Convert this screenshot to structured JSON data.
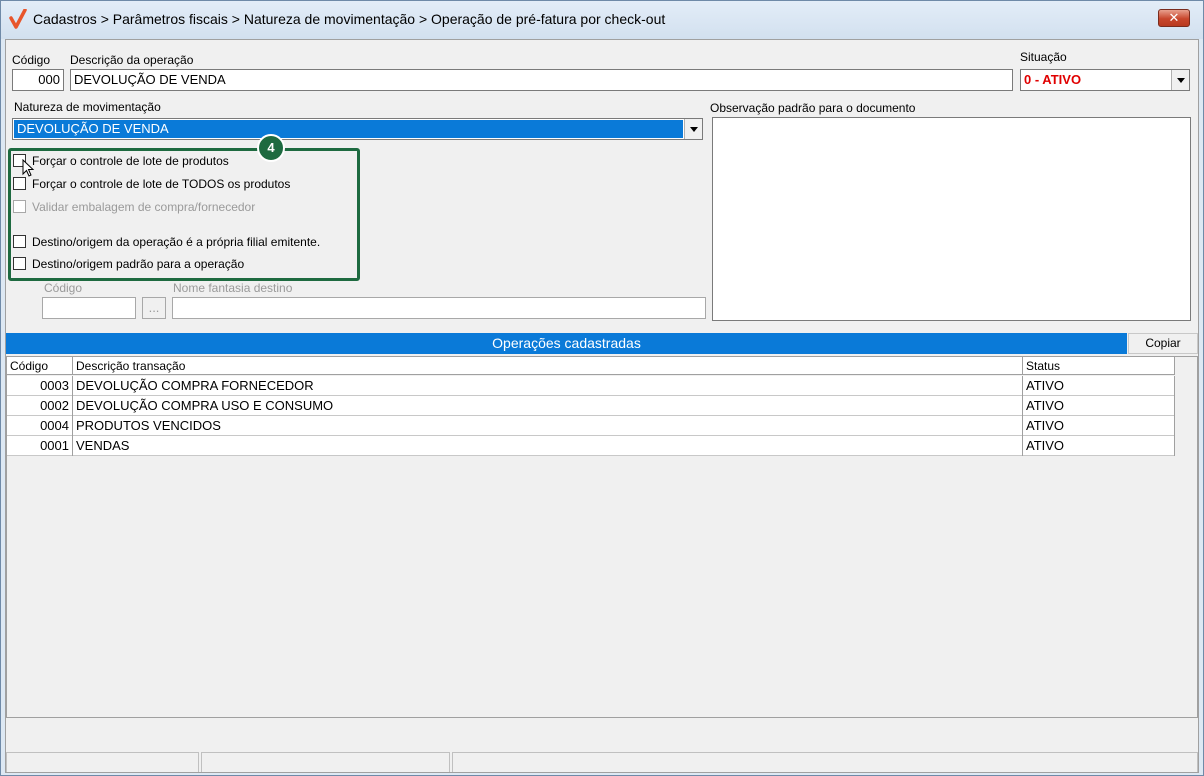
{
  "window": {
    "title": "Cadastros > Parâmetros fiscais > Natureza de movimentação > Operação de pré-fatura por check-out",
    "close_label": "✕",
    "logo_color": "#e8552b"
  },
  "form": {
    "codigo_label": "Código",
    "codigo_value": "000",
    "descricao_label": "Descrição da operação",
    "descricao_value": "DEVOLUÇÃO DE VENDA",
    "situacao_label": "Situação",
    "situacao_value": "0 - ATIVO",
    "situacao_color": "#e00000",
    "natureza_label": "Natureza de movimentação",
    "natureza_value": "DEVOLUÇÃO DE VENDA",
    "observacao_label": "Observação padrão para o documento",
    "observacao_value": ""
  },
  "checkboxes": [
    {
      "label": "Forçar o controle de lote de produtos",
      "checked": false,
      "enabled": true
    },
    {
      "label": "Forçar o controle de lote de TODOS os produtos",
      "checked": false,
      "enabled": true
    },
    {
      "label": "Validar embalagem de compra/fornecedor",
      "checked": false,
      "enabled": false
    },
    {
      "label": "Destino/origem da operação é a própria filial emitente.",
      "checked": false,
      "enabled": true
    },
    {
      "label": "Destino/origem padrão para a operação",
      "checked": false,
      "enabled": true
    }
  ],
  "highlight": {
    "badge": "4",
    "color": "#1e6a40"
  },
  "destino": {
    "codigo_label": "Código",
    "codigo_value": "",
    "browse_label": "...",
    "nome_label": "Nome fantasia destino",
    "nome_value": ""
  },
  "operacoes": {
    "title": "Operações cadastradas",
    "copy_label": "Copiar",
    "columns": [
      "Código",
      "Descrição transação",
      "Status"
    ],
    "rows": [
      {
        "codigo": "0003",
        "descricao": "DEVOLUÇÃO COMPRA FORNECEDOR",
        "status": "ATIVO"
      },
      {
        "codigo": "0002",
        "descricao": "DEVOLUÇÃO COMPRA USO E CONSUMO",
        "status": "ATIVO"
      },
      {
        "codigo": "0004",
        "descricao": "PRODUTOS VENCIDOS",
        "status": "ATIVO"
      },
      {
        "codigo": "0001",
        "descricao": "VENDAS",
        "status": "ATIVO"
      }
    ]
  }
}
